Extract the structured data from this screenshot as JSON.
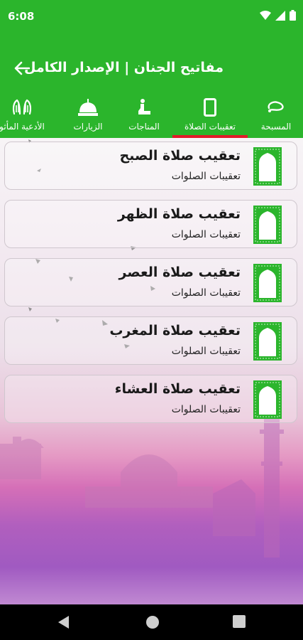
{
  "status_bar": {
    "time": "6:08",
    "icons": [
      "wifi-icon",
      "signal-icon",
      "battery-icon"
    ]
  },
  "app_bar": {
    "title": "مفاتيح الجنان | الإصدار الكامل",
    "back_icon": "arrow-left-icon"
  },
  "colors": {
    "primary": "#2bb52c",
    "tab_indicator": "#e11a2a",
    "card_icon_green": "#2bb52c"
  },
  "tabs": [
    {
      "label": "المسبحة",
      "icon": "rosary-icon"
    },
    {
      "label": "تعقيبات الصلاة",
      "icon": "phone-icon",
      "selected": true
    },
    {
      "label": "المناجات",
      "icon": "praying-person-icon"
    },
    {
      "label": "الزيارات",
      "icon": "dome-icon"
    },
    {
      "label": "الأدعية المأثو",
      "icon": "raised-hands-icon"
    }
  ],
  "items": [
    {
      "title": "تعقيب صلاة الصبح",
      "subtitle": "تعقيبات الصلوات"
    },
    {
      "title": "تعقيب صلاة الظهر",
      "subtitle": "تعقيبات الصلوات"
    },
    {
      "title": "تعقيب صلاة العصر",
      "subtitle": "تعقيبات الصلوات"
    },
    {
      "title": "تعقيب صلاة المغرب",
      "subtitle": "تعقيبات الصلوات"
    },
    {
      "title": "تعقيب صلاة العشاء",
      "subtitle": "تعقيبات الصلوات"
    }
  ],
  "nav_bar": {
    "buttons": [
      "back-triangle-icon",
      "home-circle-icon",
      "recents-square-icon"
    ]
  }
}
